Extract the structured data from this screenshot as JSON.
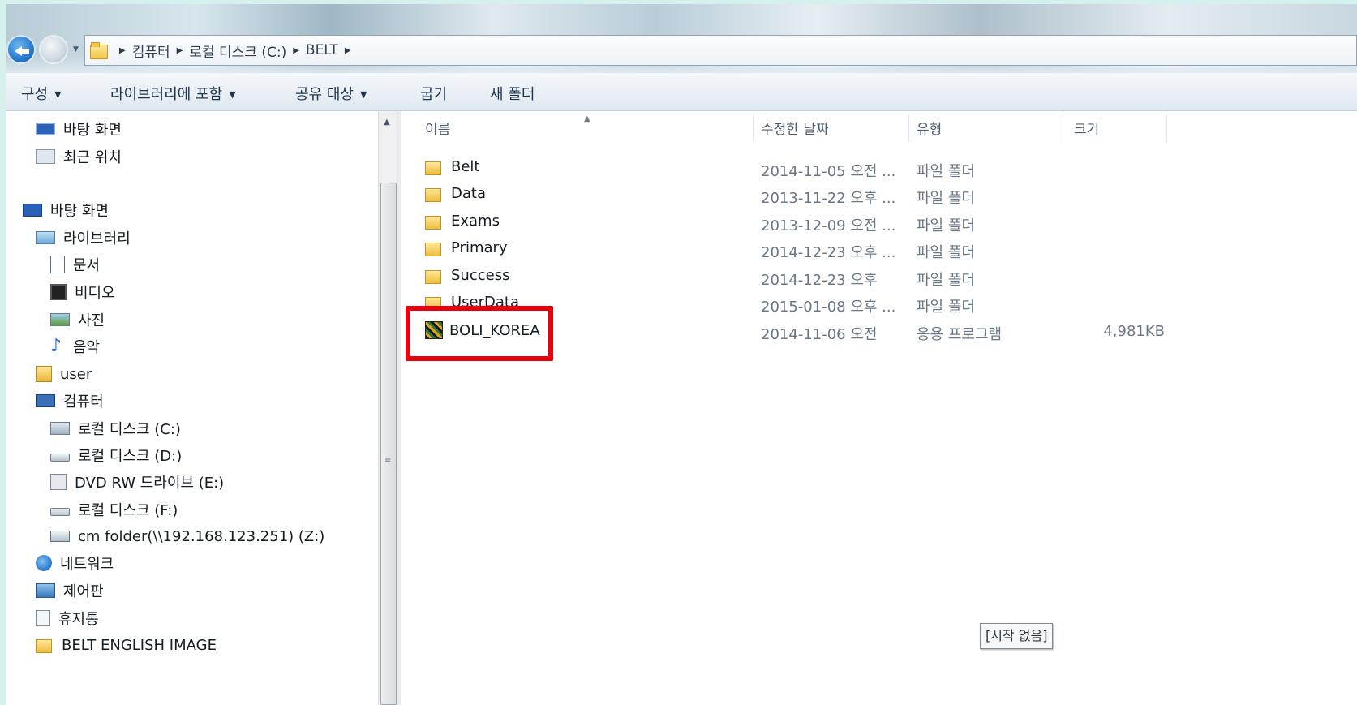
{
  "address": {
    "crumbs": [
      "컴퓨터",
      "로컬 디스크 (C:)",
      "BELT"
    ]
  },
  "toolbar": {
    "organize": "구성",
    "include_library": "라이브러리에 포함",
    "share_with": "공유 대상",
    "burn": "굽기",
    "new_folder": "새 폴더"
  },
  "nav": {
    "favorites": [
      {
        "label": "바탕 화면",
        "icon": "monitor-icon"
      },
      {
        "label": "최근 위치",
        "icon": "recent-places-icon"
      }
    ],
    "desktop": "바탕 화면",
    "libraries": "라이브러리",
    "library_items": [
      "문서",
      "비디오",
      "사진",
      "음악"
    ],
    "user": "user",
    "computer": "컴퓨터",
    "drives": [
      {
        "label": "로컬 디스크 (C:)",
        "icon": "local-disk-icon",
        "selected": true
      },
      {
        "label": "로컬 디스크 (D:)",
        "icon": "drive-icon",
        "selected": false
      },
      {
        "label": "DVD RW 드라이브 (E:)",
        "icon": "dvd-drive-icon",
        "selected": false
      },
      {
        "label": "로컬 디스크 (F:)",
        "icon": "drive-icon",
        "selected": false
      },
      {
        "label": "cm folder(\\\\192.168.123.251) (Z:)",
        "icon": "network-drive-icon",
        "selected": false
      }
    ],
    "network": "네트워크",
    "control_panel": "제어판",
    "recycle_bin": "휴지통",
    "belt_image": "BELT ENGLISH IMAGE"
  },
  "columns": {
    "name": "이름",
    "date": "수정한 날짜",
    "type": "유형",
    "size": "크기"
  },
  "files": [
    {
      "name": "Belt",
      "date": "2014-11-05 오전 ...",
      "type": "파일 폴더",
      "size": "",
      "icon": "folder-icon"
    },
    {
      "name": "Data",
      "date": "2013-11-22 오후 ...",
      "type": "파일 폴더",
      "size": "",
      "icon": "folder-icon"
    },
    {
      "name": "Exams",
      "date": "2013-12-09 오전 ...",
      "type": "파일 폴더",
      "size": "",
      "icon": "folder-icon"
    },
    {
      "name": "Primary",
      "date": "2014-12-23 오후 ...",
      "type": "파일 폴더",
      "size": "",
      "icon": "folder-icon"
    },
    {
      "name": "Success",
      "date": "2014-12-23 오후",
      "type": "파일 폴더",
      "size": "",
      "icon": "folder-icon"
    },
    {
      "name": "UserData",
      "date": "2015-01-08 오후 ...",
      "type": "파일 폴더",
      "size": "",
      "icon": "folder-icon"
    },
    {
      "name": "BOLI_KOREA",
      "date": "2014-11-06 오전",
      "type": "응용 프로그램",
      "size": "4,981KB",
      "icon": "application-icon"
    }
  ],
  "status_tooltip": "[시작 없음]",
  "colors": {
    "highlight": "#e8000c",
    "selection": "#eef0f2"
  }
}
